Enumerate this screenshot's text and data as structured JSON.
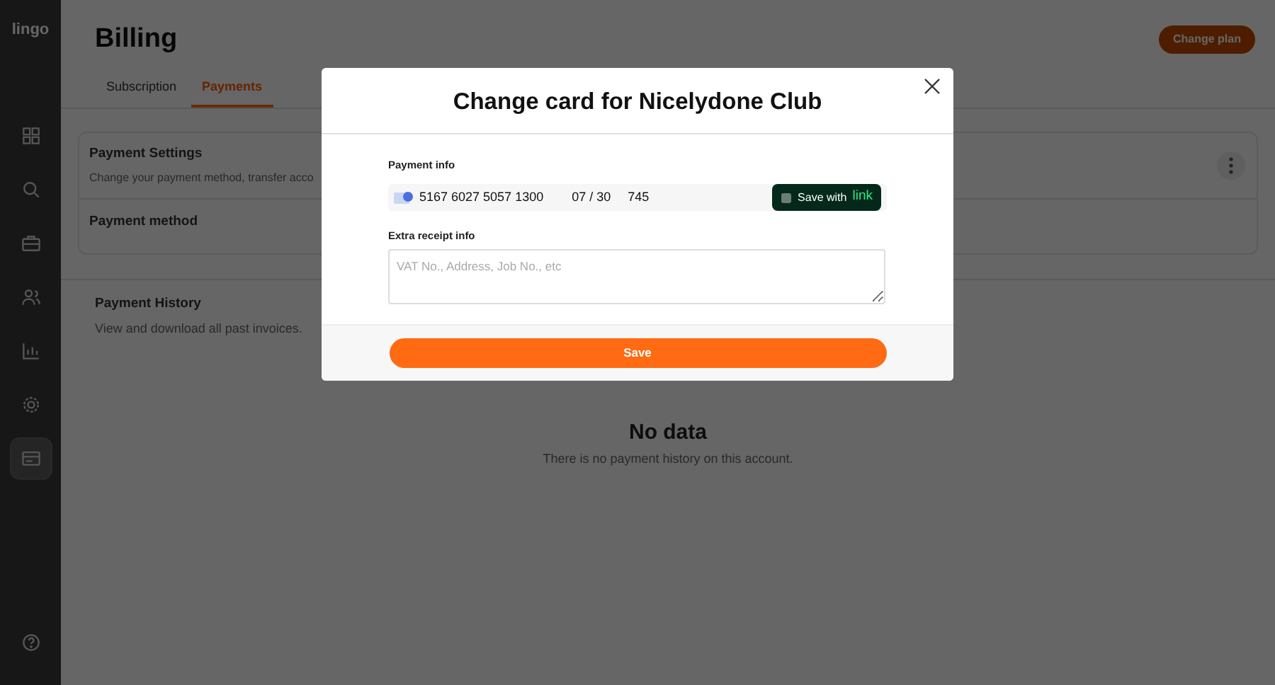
{
  "sidebar": {
    "logo": "lingo",
    "items": [
      {
        "selected": false
      },
      {
        "selected": false
      },
      {
        "selected": false
      },
      {
        "selected": false
      },
      {
        "selected": false
      },
      {
        "selected": false
      },
      {
        "selected": true
      }
    ]
  },
  "page": {
    "title": "Billing",
    "action": "Change plan",
    "tabs": [
      {
        "label": "Subscription",
        "selected": false
      },
      {
        "label": "Payments",
        "selected": true
      }
    ],
    "settings": {
      "title": "Payment Settings",
      "subtitle": "Change your payment method, transfer acco",
      "method_title": "Payment method"
    },
    "history": {
      "title": "Payment History",
      "subtitle": "View and download all past invoices."
    },
    "empty": {
      "title": "No data",
      "text": "There is no payment history on this account."
    }
  },
  "modal": {
    "title": "Change card for Nicelydone Club",
    "payment_label": "Payment info",
    "card_number": "5167 6027 5057 1300",
    "expiry": "07 / 30",
    "cvc": "745",
    "link_button": {
      "text": "Save with",
      "brand": "link"
    },
    "receipt_label": "Extra receipt info",
    "receipt_placeholder": "VAT No., Address, Job No., etc",
    "save": "Save"
  }
}
